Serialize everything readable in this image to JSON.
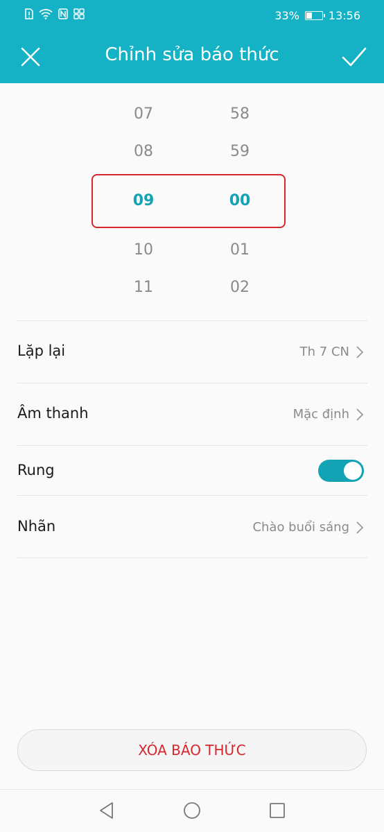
{
  "status_bar": {
    "battery_percent": "33%",
    "time": "13:56",
    "battery_level": 0.33
  },
  "header": {
    "title": "Chỉnh sửa báo thức",
    "close_icon": "close-icon",
    "confirm_icon": "check-icon"
  },
  "picker": {
    "hours": [
      "07",
      "08",
      "09",
      "10",
      "11"
    ],
    "minutes": [
      "58",
      "59",
      "00",
      "01",
      "02"
    ],
    "selected_hour": "09",
    "selected_minute": "00"
  },
  "settings": {
    "repeat": {
      "label": "Lặp lại",
      "value": "Th 7 CN"
    },
    "sound": {
      "label": "Âm thanh",
      "value": "Mặc định"
    },
    "vibrate": {
      "label": "Rung",
      "enabled": true
    },
    "label": {
      "label": "Nhãn",
      "value": "Chào buổi sáng"
    }
  },
  "delete_button": "XÓA BÁO THỨC",
  "colors": {
    "accent": "#14b2c4",
    "danger": "#d8262d"
  }
}
